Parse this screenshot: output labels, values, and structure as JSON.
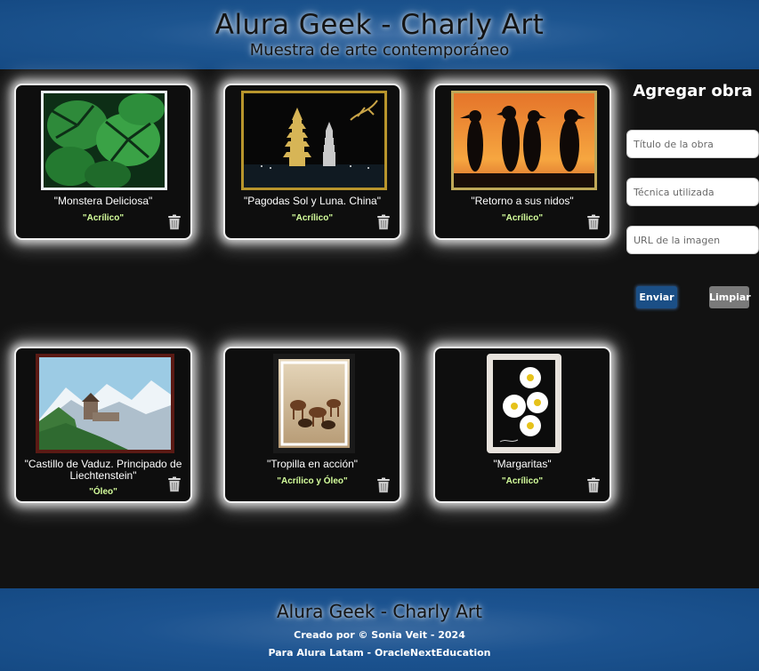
{
  "header": {
    "title": "Alura Geek - Charly Art",
    "subtitle": "Muestra de arte contemporáneo"
  },
  "gallery": {
    "items": [
      {
        "title": "\"Monstera Deliciosa\"",
        "technique": "\"Acrílico\"",
        "image": "monstera-painting"
      },
      {
        "title": "\"Pagodas Sol y Luna. China\"",
        "technique": "\"Acrílico\"",
        "image": "pagodas-painting"
      },
      {
        "title": "\"Retorno a sus nidos\"",
        "technique": "\"Acrílico\"",
        "image": "penguins-painting"
      },
      {
        "title": "\"Castillo de Vaduz. Principado de Liechtenstein\"",
        "technique": "\"Óleo\"",
        "image": "castle-painting"
      },
      {
        "title": "\"Tropilla en acción\"",
        "technique": "\"Acrílico y Óleo\"",
        "image": "horses-painting"
      },
      {
        "title": "\"Margaritas\"",
        "technique": "\"Acrílico\"",
        "image": "daisies-painting"
      }
    ],
    "delete_icon": "trash-icon"
  },
  "form": {
    "title": "Agregar obra",
    "title_placeholder": "Título de la obra",
    "technique_placeholder": "Técnica utilizada",
    "url_placeholder": "URL de la imagen",
    "send_label": "Enviar",
    "clear_label": "Limpiar"
  },
  "footer": {
    "title": "Alura Geek - Charly Art",
    "credit": "Creado por © Sonia Veit - 2024",
    "for": "Para Alura Latam - OracleNextEducation"
  },
  "colors": {
    "brand_blue": "#154a84",
    "background": "#121212",
    "technique_green": "#d5ff9c",
    "send_button": "#1b4f86",
    "clear_button": "#7a7a7a"
  }
}
